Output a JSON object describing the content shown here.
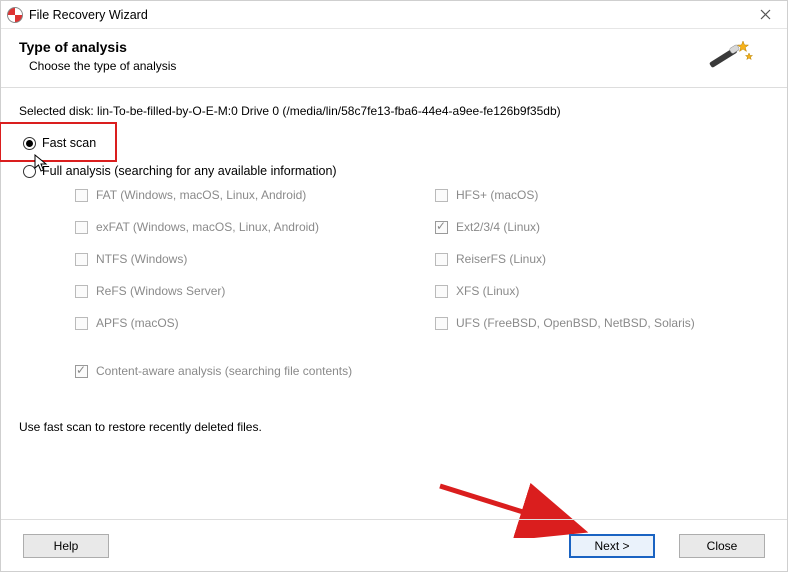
{
  "window": {
    "title": "File Recovery Wizard"
  },
  "header": {
    "title": "Type of analysis",
    "subtitle": "Choose the type of analysis"
  },
  "disk": {
    "label": "Selected disk: lin-To-be-filled-by-O-E-M:0 Drive 0 (/media/lin/58c7fe13-fba6-44e4-a9ee-fe126b9f35db)"
  },
  "scan": {
    "fast_label": "Fast scan",
    "full_label": "Full analysis (searching for any available information)"
  },
  "filesystems": {
    "left": [
      "FAT (Windows, macOS, Linux, Android)",
      "exFAT (Windows, macOS, Linux, Android)",
      "NTFS (Windows)",
      "ReFS (Windows Server)",
      "APFS (macOS)"
    ],
    "right": [
      "HFS+ (macOS)",
      "Ext2/3/4 (Linux)",
      "ReiserFS (Linux)",
      "XFS (Linux)",
      "UFS (FreeBSD, OpenBSD, NetBSD, Solaris)"
    ]
  },
  "content_aware": {
    "label": "Content-aware analysis (searching file contents)"
  },
  "hint": {
    "text": "Use fast scan to restore recently deleted files."
  },
  "buttons": {
    "help": "Help",
    "next": "Next >",
    "close": "Close"
  }
}
